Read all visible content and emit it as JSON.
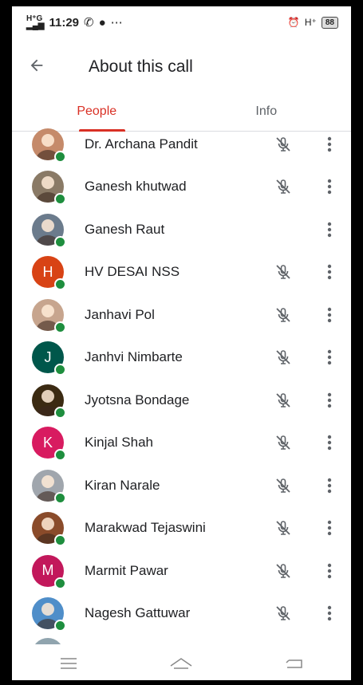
{
  "status": {
    "time": "11:29",
    "battery": "88"
  },
  "appbar": {
    "title": "About this call"
  },
  "tabs": [
    {
      "label": "People",
      "active": true
    },
    {
      "label": "Info",
      "active": false
    }
  ],
  "participants": [
    {
      "name": "Dr. Archana Pandit",
      "avatar": "photo",
      "color": "#c58a6a",
      "muted": true
    },
    {
      "name": "Ganesh khutwad",
      "avatar": "photo",
      "color": "#8a7a66",
      "muted": true
    },
    {
      "name": "Ganesh Raut",
      "avatar": "photo",
      "color": "#6b7b8c",
      "muted": false
    },
    {
      "name": "HV DESAI NSS",
      "avatar": "H",
      "color": "#d84315",
      "muted": true
    },
    {
      "name": "Janhavi Pol",
      "avatar": "photo",
      "color": "#c7a58e",
      "muted": true
    },
    {
      "name": "Janhvi Nimbarte",
      "avatar": "J",
      "color": "#00574b",
      "muted": true
    },
    {
      "name": "Jyotsna Bondage",
      "avatar": "photo",
      "color": "#3b2a12",
      "muted": true
    },
    {
      "name": "Kinjal Shah",
      "avatar": "K",
      "color": "#d81b60",
      "muted": true
    },
    {
      "name": "Kiran Narale",
      "avatar": "photo",
      "color": "#a0a6ad",
      "muted": true
    },
    {
      "name": "Marakwad Tejaswini",
      "avatar": "photo",
      "color": "#8a4b2a",
      "muted": true
    },
    {
      "name": "Marmit Pawar",
      "avatar": "M",
      "color": "#c2185b",
      "muted": true
    },
    {
      "name": "Nagesh Gattuwar",
      "avatar": "photo",
      "color": "#4f8ec9",
      "muted": true
    }
  ],
  "icons": {
    "back": "arrow-back-icon",
    "muted": "mic-off-icon",
    "more": "more-vert-icon"
  }
}
